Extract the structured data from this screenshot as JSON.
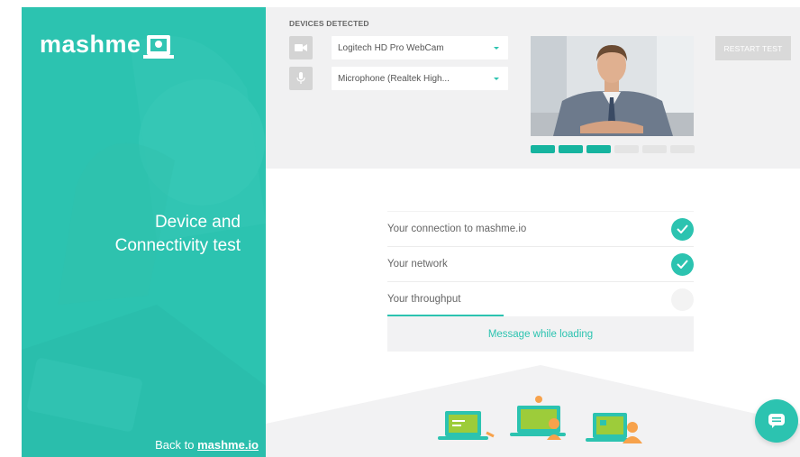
{
  "brand": {
    "logo_text": "mashme"
  },
  "left_panel": {
    "title_line1": "Device and",
    "title_line2": "Connectivity test",
    "back_prefix": "Back to",
    "back_link": "mashme.io"
  },
  "devices": {
    "header": "DEVICES DETECTED",
    "camera": {
      "icon": "video-camera-icon",
      "selected": "Logitech HD Pro WebCam"
    },
    "microphone": {
      "icon": "microphone-icon",
      "selected": "Microphone (Realtek High..."
    },
    "restart_label": "RESTART TEST",
    "level_meter": {
      "segments": 6,
      "active": 3
    }
  },
  "checks": [
    {
      "label": "Your connection to mashme.io",
      "status": "ok"
    },
    {
      "label": "Your network",
      "status": "ok"
    },
    {
      "label": "Your throughput",
      "status": "pending",
      "progress": 0.38
    }
  ],
  "message": "Message while loading",
  "colors": {
    "accent": "#2cc3b0",
    "accent_dark": "#16b49f",
    "band_bg": "#f1f1f2",
    "lime": "#9dcc3a",
    "orange": "#f7a24b"
  }
}
